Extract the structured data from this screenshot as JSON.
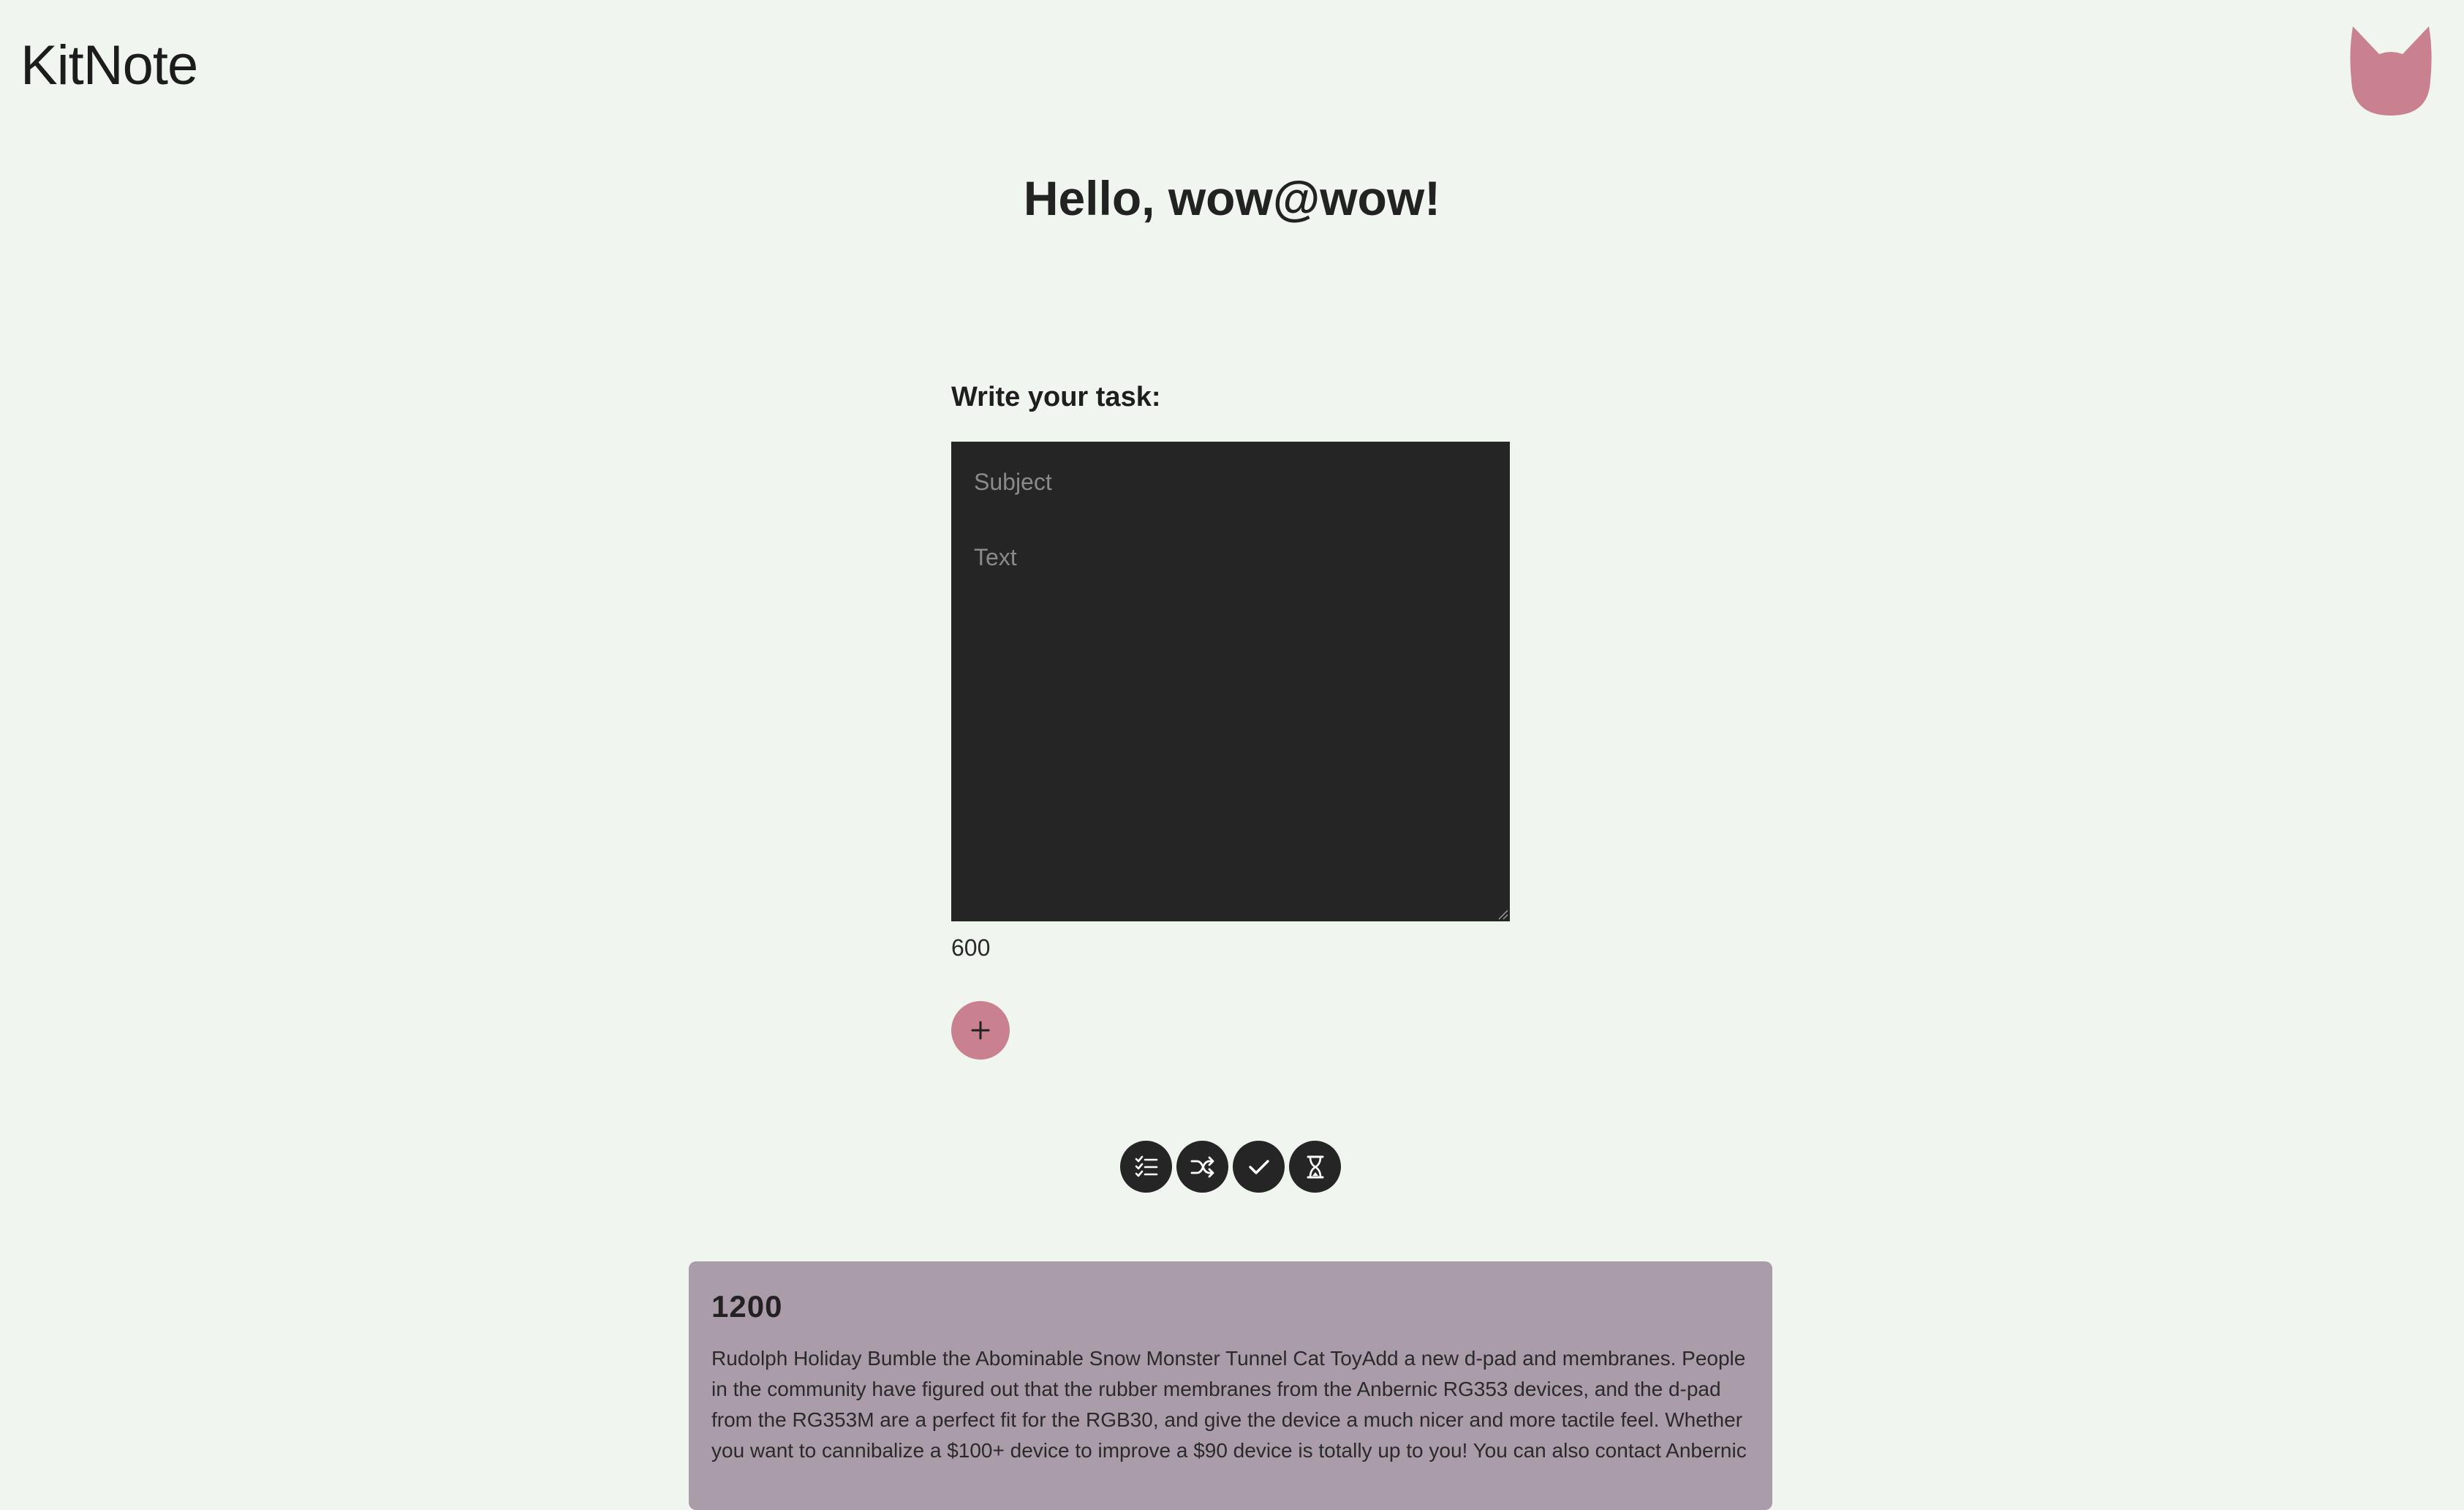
{
  "header": {
    "logo_text": "KitNote",
    "avatar_icon": "cat-head-icon",
    "avatar_color": "#c9808f"
  },
  "greeting": "Hello, wow@wow!",
  "task_form": {
    "label": "Write your task:",
    "subject_placeholder": "Subject",
    "subject_value": "",
    "text_placeholder": "Text",
    "text_value": "",
    "char_count": "600",
    "add_button_icon": "plus-icon",
    "background_color": "#252525"
  },
  "filters": [
    {
      "name": "all",
      "icon": "checklist-icon"
    },
    {
      "name": "shuffle",
      "icon": "shuffle-icon"
    },
    {
      "name": "completed",
      "icon": "check-icon"
    },
    {
      "name": "pending",
      "icon": "hourglass-icon"
    }
  ],
  "notes": [
    {
      "title": "1200",
      "text": "Rudolph Holiday Bumble the Abominable Snow Monster Tunnel Cat ToyAdd a new d-pad and membranes. People in the community have figured out that the rubber membranes from the Anbernic RG353 devices, and the d-pad from the RG353M are a perfect fit for the RGB30, and give the device a much nicer and more tactile feel. Whether you want to cannibalize a $100+ device to improve a $90 device is totally up to you! You can also contact Anbernic",
      "background_color": "#ab9ca9"
    }
  ],
  "colors": {
    "page_background": "#f1f5ef",
    "accent": "#c9808f",
    "dark": "#252525"
  }
}
